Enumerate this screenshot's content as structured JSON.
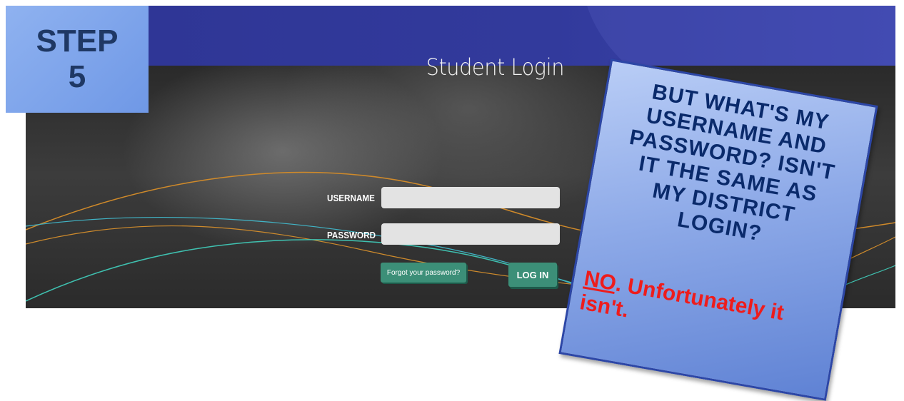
{
  "step": {
    "line1": "STEP",
    "line2": "5"
  },
  "login": {
    "title": "Student Login",
    "username_label": "USERNAME",
    "password_label": "PASSWORD",
    "username_value": "",
    "password_value": "",
    "forgot_label": "Forgot your password?",
    "login_label": "LOG IN"
  },
  "callout": {
    "question": "BUT WHAT'S MY\nUSERNAME AND\nPASSWORD? ISN'T\nIT THE SAME AS\nMY DISTRICT\nLOGIN?",
    "answer_no": "NO",
    "answer_rest": ". Unfortunately it isn't."
  },
  "colors": {
    "banner": "#2e3594",
    "step_box": "#7ea5ea",
    "button": "#3c8f78",
    "callout_text": "#0a2a6b",
    "answer_text": "#ee1c1c"
  }
}
